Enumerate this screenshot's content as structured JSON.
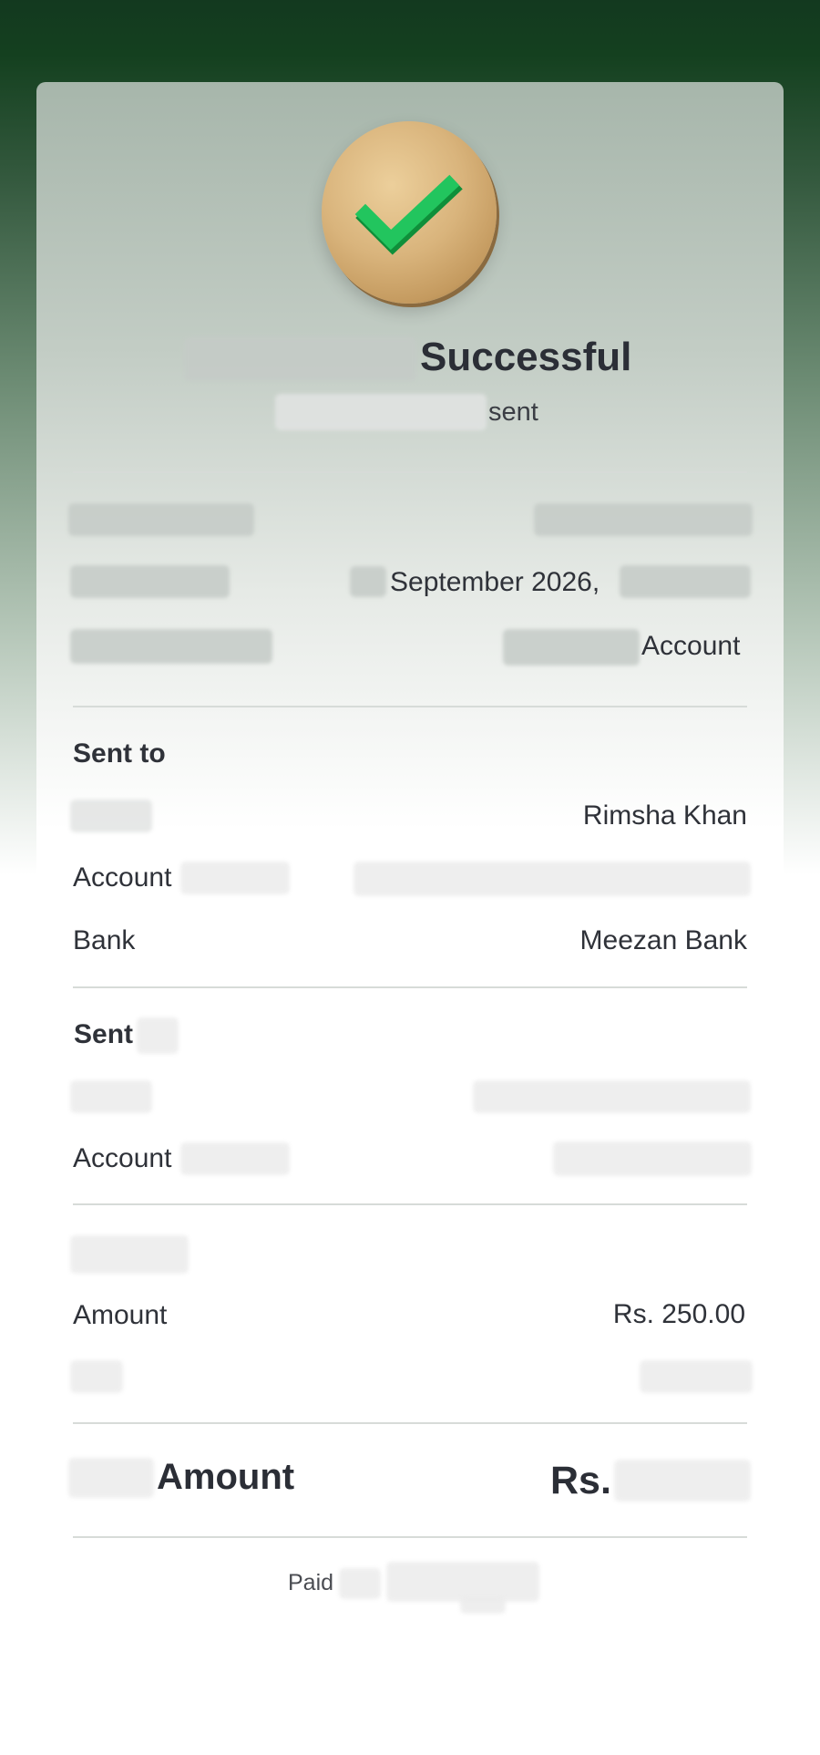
{
  "receipt": {
    "status_title": "Successful",
    "status_sub": "sent",
    "date_value": "September 2026,",
    "account_type_value": "Account",
    "sent_to": {
      "heading": "Sent to",
      "name_value": "Rimsha Khan",
      "account_label": "Account",
      "bank_label": "Bank",
      "bank_value": "Meezan Bank"
    },
    "sent_from": {
      "heading": "Sent",
      "account_label": "Account"
    },
    "amount": {
      "label": "Amount",
      "value": "Rs. 250.00"
    },
    "total": {
      "label": "Amount",
      "currency": "Rs."
    },
    "footer": {
      "paid_label": "Paid"
    }
  },
  "colors": {
    "header_dark_green": "#13391f",
    "check_green": "#1fbf4f",
    "coin_gold": "#d9b47c"
  },
  "icons": {
    "success": "checkmark-coin-icon"
  }
}
